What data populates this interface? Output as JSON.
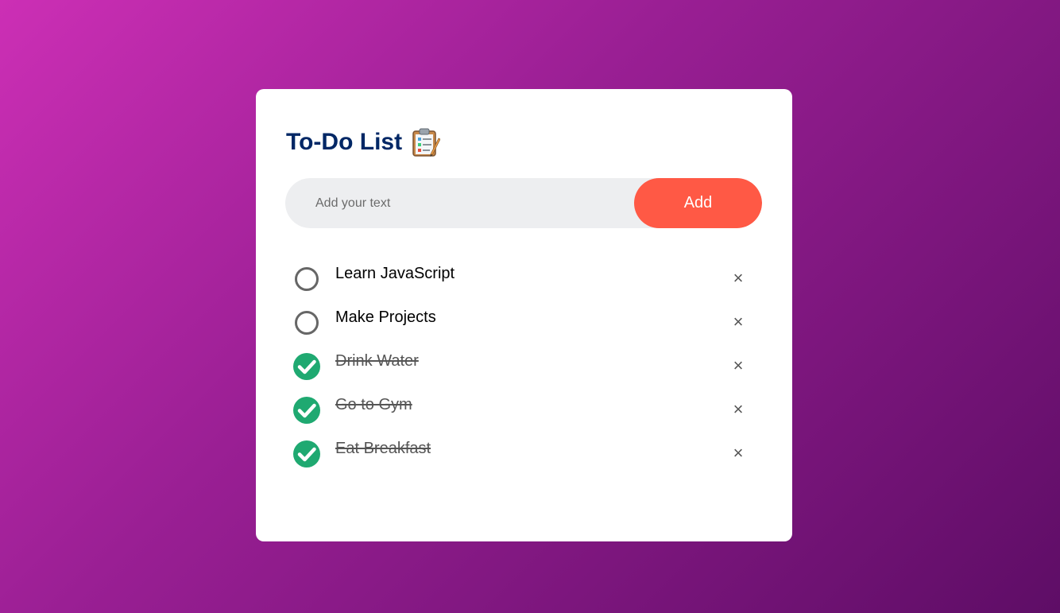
{
  "app": {
    "title": "To-Do List",
    "title_icon": "clipboard-icon"
  },
  "input": {
    "placeholder": "Add your text",
    "value": "",
    "add_label": "Add"
  },
  "tasks": [
    {
      "label": "Learn JavaScript",
      "done": false
    },
    {
      "label": "Make Projects",
      "done": false
    },
    {
      "label": "Drink Water",
      "done": true
    },
    {
      "label": "Go to Gym",
      "done": true
    },
    {
      "label": "Eat Breakfast",
      "done": true
    }
  ],
  "delete_glyph": "×",
  "colors": {
    "title": "#002765",
    "accent": "#ff5945",
    "checked": "#1fa971",
    "unchecked": "#666666"
  }
}
